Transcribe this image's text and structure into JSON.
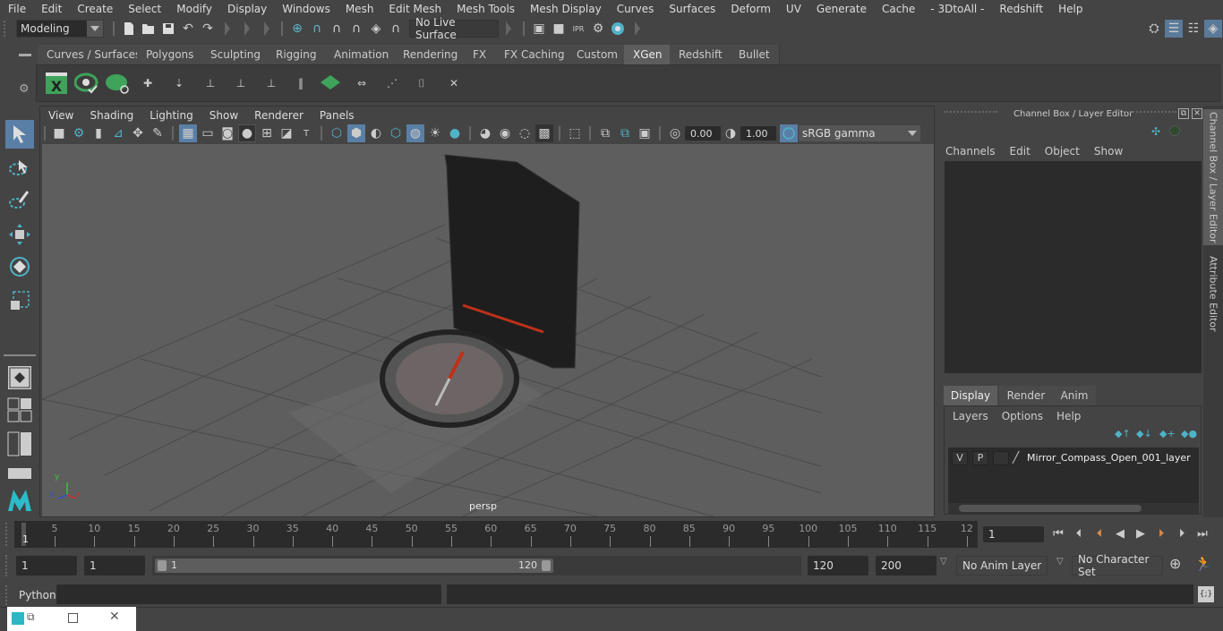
{
  "menubar": [
    "File",
    "Edit",
    "Create",
    "Select",
    "Modify",
    "Display",
    "Windows",
    "Mesh",
    "Edit Mesh",
    "Mesh Tools",
    "Mesh Display",
    "Curves",
    "Surfaces",
    "Deform",
    "UV",
    "Generate",
    "Cache",
    "- 3DtoAll -",
    "Redshift",
    "Help"
  ],
  "statusline": {
    "mode": "Modeling",
    "live_surface": "No Live Surface"
  },
  "shelf": {
    "tabs": [
      "Curves / Surfaces",
      "Polygons",
      "Sculpting",
      "Rigging",
      "Animation",
      "Rendering",
      "FX",
      "FX Caching",
      "Custom",
      "XGen",
      "Redshift",
      "Bullet"
    ],
    "active_tab": "XGen",
    "icons": [
      "xgen-window-icon",
      "preview-eye-check-icon",
      "preview-eye-clear-icon",
      "add-guides-icon",
      "place-guides-icon",
      "add-guide-icon",
      "show-guides-icon",
      "lock-guides-icon",
      "split-guides-icon",
      "grid-patch-icon",
      "guide-length-icon",
      "select-guides-icon",
      "region-select-icon",
      "delete-guides-icon"
    ]
  },
  "viewport": {
    "menu": [
      "View",
      "Shading",
      "Lighting",
      "Show",
      "Renderer",
      "Panels"
    ],
    "exposure": "0.00",
    "gamma": "1.00",
    "color_space": "sRGB gamma",
    "camera_label": "persp",
    "axis": {
      "x": "x",
      "y": "y",
      "z": "z"
    }
  },
  "channel_box": {
    "title": "Channel Box / Layer Editor",
    "menu": [
      "Channels",
      "Edit",
      "Object",
      "Show"
    ],
    "layer_tabs": [
      "Display",
      "Render",
      "Anim"
    ],
    "active_layer_tab": "Display",
    "layer_menu": [
      "Layers",
      "Options",
      "Help"
    ],
    "layers": [
      {
        "v": "V",
        "p": "P",
        "name": "Mirror_Compass_Open_001_layer"
      }
    ]
  },
  "side_tabs": [
    "Channel Box / Layer Editor",
    "Attribute Editor"
  ],
  "timeline": {
    "ticks": [
      "5",
      "10",
      "15",
      "20",
      "25",
      "30",
      "35",
      "40",
      "45",
      "50",
      "55",
      "60",
      "65",
      "70",
      "75",
      "80",
      "85",
      "90",
      "95",
      "100",
      "105",
      "110",
      "115",
      "12"
    ],
    "current_frame_marker": "1",
    "current_frame": "1"
  },
  "range": {
    "start": "1",
    "anim_start": "1",
    "slider_start": "1",
    "slider_end": "120",
    "anim_end": "120",
    "end": "200",
    "anim_layer": "No Anim Layer",
    "character_set": "No Character Set"
  },
  "cmdline": {
    "label": "Python"
  }
}
